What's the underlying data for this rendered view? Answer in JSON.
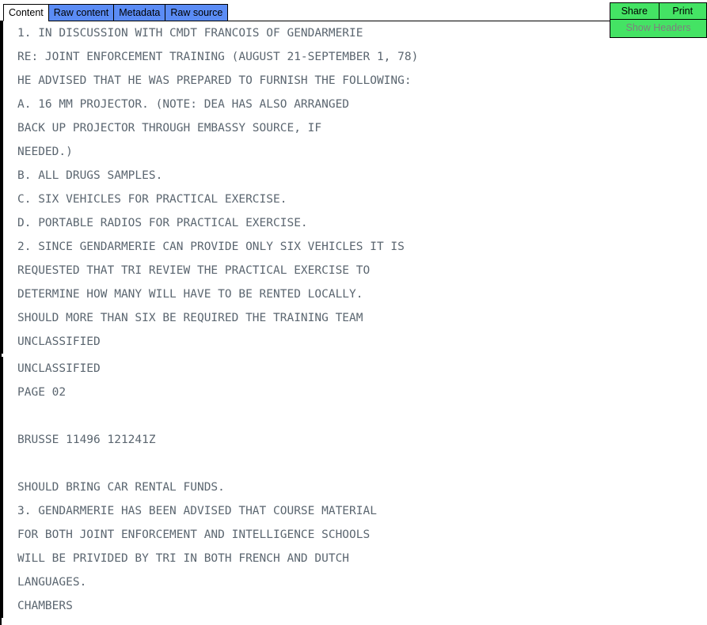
{
  "tabs": [
    {
      "label": "Content",
      "active": true
    },
    {
      "label": "Raw content",
      "active": false
    },
    {
      "label": "Metadata",
      "active": false
    },
    {
      "label": "Raw source",
      "active": false
    }
  ],
  "actions": {
    "share_label": "Share",
    "print_label": "Print",
    "show_headers_label": "Show Headers"
  },
  "colors": {
    "tab_inactive_bg": "#5b8cf5",
    "tab_active_bg": "#ffffff",
    "action_bg": "#44e364",
    "action_text": "#000000",
    "show_headers_text": "#7f7f7f",
    "document_text": "#5b6670",
    "border": "#000000"
  },
  "document": {
    "pages": [
      {
        "lines": [
          "1. IN DISCUSSION WITH CMDT FRANCOIS OF GENDARMERIE",
          "RE: JOINT ENFORCEMENT TRAINING (AUGUST 21-SEPTEMBER 1, 78)",
          "HE ADVISED THAT HE WAS PREPARED TO FURNISH THE FOLLOWING:",
          "A. 16 MM PROJECTOR. (NOTE: DEA HAS ALSO ARRANGED",
          "BACK UP PROJECTOR THROUGH EMBASSY SOURCE, IF",
          "NEEDED.)",
          "B. ALL DRUGS SAMPLES.",
          "C. SIX VEHICLES FOR PRACTICAL EXERCISE.",
          "D. PORTABLE RADIOS FOR PRACTICAL EXERCISE.",
          "2. SINCE GENDARMERIE CAN PROVIDE ONLY SIX VEHICLES IT IS",
          "REQUESTED THAT TRI REVIEW THE PRACTICAL EXERCISE TO",
          "DETERMINE HOW MANY WILL HAVE TO BE RENTED LOCALLY.",
          "SHOULD MORE THAN SIX BE REQUIRED THE TRAINING TEAM",
          "UNCLASSIFIED"
        ]
      },
      {
        "lines": [
          "UNCLASSIFIED",
          "PAGE 02",
          "",
          "BRUSSE 11496 121241Z",
          "",
          "SHOULD BRING CAR RENTAL FUNDS.",
          "3. GENDARMERIE HAS BEEN ADVISED THAT COURSE MATERIAL",
          "FOR BOTH JOINT ENFORCEMENT AND INTELLIGENCE SCHOOLS",
          "WILL BE PRIVIDED BY TRI IN BOTH FRENCH AND DUTCH",
          "LANGUAGES.",
          "CHAMBERS"
        ]
      }
    ]
  }
}
